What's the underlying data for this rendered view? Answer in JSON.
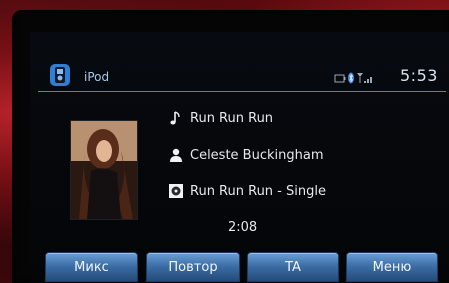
{
  "status_bar": {
    "source_label": "iPod",
    "clock": "5:53",
    "icons": [
      "battery-icon",
      "bluetooth-icon",
      "signal-icon"
    ]
  },
  "now_playing": {
    "track": "Run Run Run",
    "artist": "Celeste Buckingham",
    "album": "Run Run Run - Single",
    "elapsed": "2:08"
  },
  "softkeys": [
    {
      "label": "Микс"
    },
    {
      "label": "Повтор"
    },
    {
      "label": "TA"
    },
    {
      "label": "Меню"
    }
  ],
  "colors": {
    "accent": "#2f7fd6",
    "softkey": "#3d6fa8",
    "text": "#e6e8ec",
    "source_label": "#a9c6ea"
  }
}
